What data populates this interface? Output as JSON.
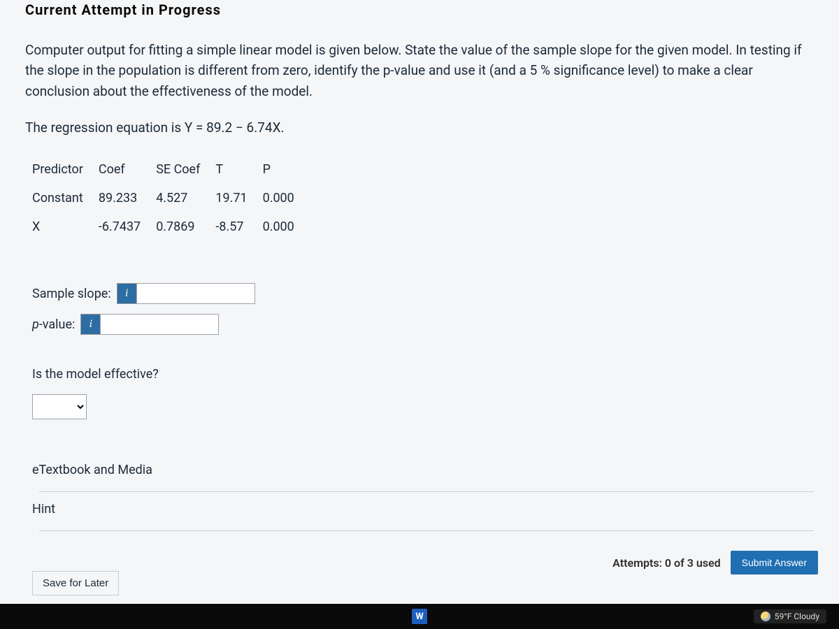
{
  "header_fragment": "Current Attempt in Progress",
  "prompt_text": "Computer output for fitting a simple linear model is given below. State the value of the sample slope for the given model. In testing if the slope in the population is different from zero, identify the p-value and use it (and a 5 % significance level) to make a clear conclusion about the effectiveness of the model.",
  "equation_prefix": "The regression equation is ",
  "equation_expr": "Y = 89.2 − 6.74X.",
  "table": {
    "headers": [
      "Predictor",
      "Coef",
      "SE Coef",
      "T",
      "P"
    ],
    "rows": [
      {
        "predictor": "Constant",
        "coef": "89.233",
        "se": "4.527",
        "t": "19.71",
        "p": "0.000"
      },
      {
        "predictor": "X",
        "coef": "-6.7437",
        "se": "0.7869",
        "t": "-8.57",
        "p": "0.000"
      }
    ]
  },
  "labels": {
    "sample_slope": "Sample slope:",
    "pvalue_prefix": "p",
    "pvalue_suffix": "-value:",
    "info_glyph": "i",
    "model_effective": "Is the model effective?",
    "etextbook": "eTextbook and Media",
    "hint": "Hint",
    "save_later": "Save for Later",
    "attempts": "Attempts: 0 of 3 used",
    "submit": "Submit Answer"
  },
  "inputs": {
    "sample_slope": "",
    "pvalue": "",
    "effective_selected": ""
  },
  "taskbar": {
    "app_letter": "W",
    "weather": "59°F  Cloudy"
  },
  "chart_data": {
    "type": "table",
    "title": "Simple linear regression output",
    "equation": "Y = 89.2 - 6.74X",
    "columns": [
      "Predictor",
      "Coef",
      "SE Coef",
      "T",
      "P"
    ],
    "rows": [
      [
        "Constant",
        89.233,
        4.527,
        19.71,
        0.0
      ],
      [
        "X",
        -6.7437,
        0.7869,
        -8.57,
        0.0
      ]
    ],
    "sample_slope": -6.7437,
    "p_value_slope": 0.0,
    "significance_level": 0.05
  }
}
